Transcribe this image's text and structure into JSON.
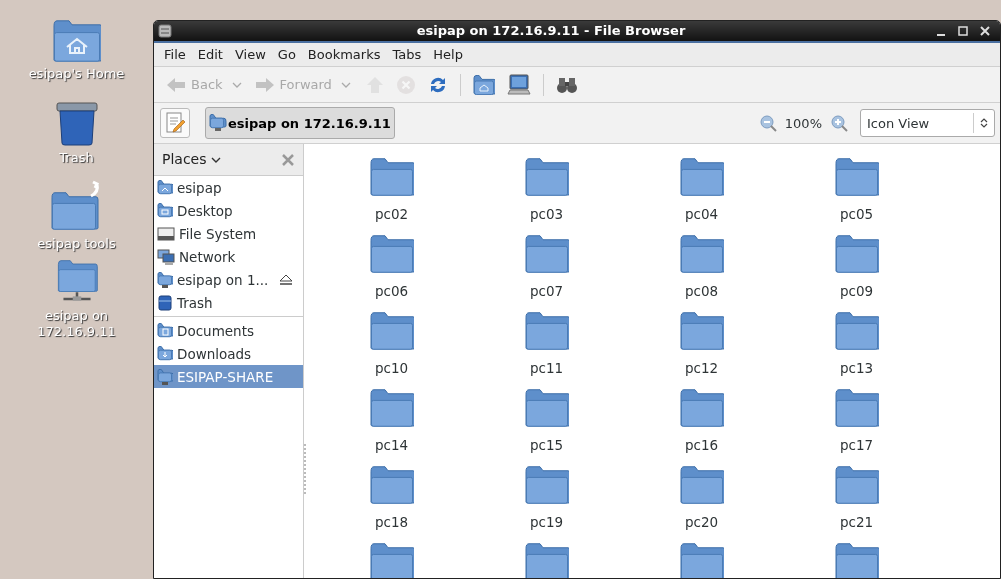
{
  "window": {
    "title": "esipap on 172.16.9.11 - File Browser"
  },
  "desktop_icons": [
    {
      "kind": "home",
      "label": "esipap's Home"
    },
    {
      "kind": "trash",
      "label": "Trash"
    },
    {
      "kind": "link-folder",
      "label": "esipap tools"
    },
    {
      "kind": "share",
      "label": "esipap on 172.16.9.11"
    }
  ],
  "menu": [
    "File",
    "Edit",
    "View",
    "Go",
    "Bookmarks",
    "Tabs",
    "Help"
  ],
  "toolbar": [
    {
      "kind": "back",
      "label": "Back",
      "disabled": true
    },
    {
      "kind": "forward",
      "label": "Forward",
      "disabled": true
    },
    {
      "kind": "up",
      "disabled": true
    },
    {
      "kind": "stop",
      "disabled": true
    },
    {
      "kind": "reload",
      "disabled": false
    },
    {
      "kind": "separator"
    },
    {
      "kind": "home",
      "disabled": false
    },
    {
      "kind": "computer",
      "disabled": false
    },
    {
      "kind": "separator"
    },
    {
      "kind": "search",
      "disabled": false
    }
  ],
  "location": {
    "path": "esipap on 172.16.9.11",
    "zoom": "100%",
    "view": "Icon View"
  },
  "sidebar": {
    "title": "Places",
    "sections": [
      {
        "items": [
          {
            "kind": "home",
            "label": "esipap",
            "eject": false,
            "selected": false
          },
          {
            "kind": "desktop",
            "label": "Desktop",
            "eject": false,
            "selected": false
          },
          {
            "kind": "drive",
            "label": "File System",
            "eject": false,
            "selected": false
          },
          {
            "kind": "network",
            "label": "Network",
            "eject": false,
            "selected": false
          },
          {
            "kind": "share",
            "label": "esipap on 1...",
            "eject": true,
            "selected": false
          },
          {
            "kind": "trash",
            "label": "Trash",
            "eject": false,
            "selected": false
          }
        ]
      },
      {
        "items": [
          {
            "kind": "documents",
            "label": "Documents",
            "eject": false,
            "selected": false
          },
          {
            "kind": "downloads",
            "label": "Downloads",
            "eject": false,
            "selected": false
          },
          {
            "kind": "share",
            "label": "ESIPAP-SHARE",
            "eject": false,
            "selected": true
          }
        ]
      }
    ]
  },
  "folders": [
    {
      "kind": "folder",
      "label": "pc02"
    },
    {
      "kind": "folder",
      "label": "pc03"
    },
    {
      "kind": "folder",
      "label": "pc04"
    },
    {
      "kind": "folder",
      "label": "pc05"
    },
    {
      "kind": "folder",
      "label": "pc06"
    },
    {
      "kind": "folder",
      "label": "pc07"
    },
    {
      "kind": "folder",
      "label": "pc08"
    },
    {
      "kind": "folder",
      "label": "pc09"
    },
    {
      "kind": "folder",
      "label": "pc10"
    },
    {
      "kind": "folder",
      "label": "pc11"
    },
    {
      "kind": "folder",
      "label": "pc12"
    },
    {
      "kind": "folder",
      "label": "pc13"
    },
    {
      "kind": "folder",
      "label": "pc14"
    },
    {
      "kind": "folder",
      "label": "pc15"
    },
    {
      "kind": "folder",
      "label": "pc16"
    },
    {
      "kind": "folder",
      "label": "pc17"
    },
    {
      "kind": "folder",
      "label": "pc18"
    },
    {
      "kind": "folder",
      "label": "pc19"
    },
    {
      "kind": "folder",
      "label": "pc20"
    },
    {
      "kind": "folder",
      "label": "pc21"
    },
    {
      "kind": "cut"
    },
    {
      "kind": "cut"
    },
    {
      "kind": "cut"
    },
    {
      "kind": "cut"
    }
  ]
}
